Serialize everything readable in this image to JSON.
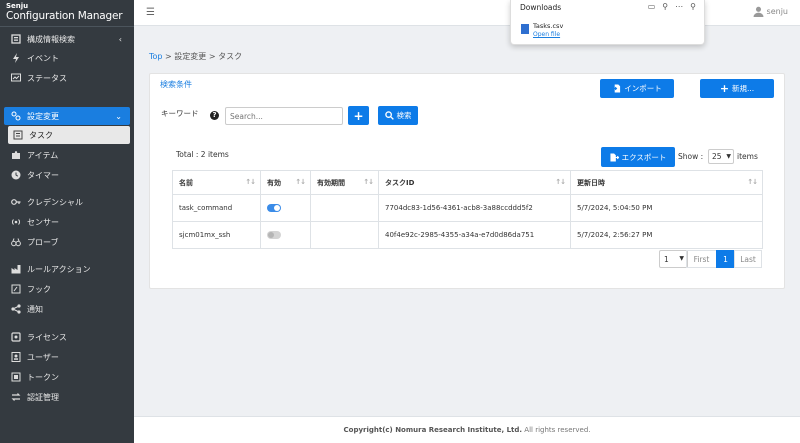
{
  "brand": {
    "line1": "Senju",
    "line2": "Configuration Manager"
  },
  "sidebar": {
    "items": [
      {
        "label": "構成情報検索",
        "icon": "catalog-icon",
        "chevron": "‹"
      },
      {
        "label": "イベント",
        "icon": "bolt-icon"
      },
      {
        "label": "ステータス",
        "icon": "monitor-icon"
      },
      {
        "label": "設定変更",
        "icon": "sliders-icon",
        "chevron": "⌄"
      },
      {
        "label": "タスク",
        "icon": "list-icon"
      },
      {
        "label": "アイテム",
        "icon": "puzzle-icon"
      },
      {
        "label": "タイマー",
        "icon": "clock-icon"
      },
      {
        "label": "クレデンシャル",
        "icon": "key-icon"
      },
      {
        "label": "センサー",
        "icon": "sensor-icon"
      },
      {
        "label": "プローブ",
        "icon": "binoculars-icon"
      },
      {
        "label": "ルールアクション",
        "icon": "factory-icon"
      },
      {
        "label": "フック",
        "icon": "hook-icon"
      },
      {
        "label": "通知",
        "icon": "share-icon"
      },
      {
        "label": "ライセンス",
        "icon": "license-icon"
      },
      {
        "label": "ユーザー",
        "icon": "user-card-icon"
      },
      {
        "label": "トークン",
        "icon": "token-icon"
      },
      {
        "label": "認証管理",
        "icon": "exchange-icon"
      }
    ]
  },
  "topbar": {
    "user": "senju"
  },
  "breadcrumb": {
    "top": "Top",
    "rest": " > 設定変更 > タスク"
  },
  "search": {
    "title": "検索条件",
    "keyword_label": "キーワード",
    "placeholder": "Search...",
    "search_button": "検索",
    "import_button": "インポート",
    "new_button": "新規..."
  },
  "list": {
    "total": "Total : 2 items",
    "export_button": "エクスポート",
    "show_label": "Show :",
    "show_value": "25",
    "items_label": "items",
    "columns": [
      "名前",
      "有効",
      "有効期間",
      "タスクID",
      "更新日時"
    ],
    "rows": [
      {
        "name": "task_command",
        "enabled": true,
        "period": "",
        "task_id": "7704dc83-1d56-4361-acb8-3a88ccddd5f2",
        "updated": "5/7/2024, 5:04:50 PM"
      },
      {
        "name": "sjcm01mx_ssh",
        "enabled": false,
        "period": "",
        "task_id": "40f4e92c-2985-4355-a34a-e7d0d86da751",
        "updated": "5/7/2024, 2:56:27 PM"
      }
    ]
  },
  "pagination": {
    "page_size": "1",
    "first": "First",
    "current": "1",
    "last": "Last"
  },
  "footer": {
    "bold": "Copyright(c) Nomura Research Institute, Ltd.",
    "rest": " All rights reserved."
  },
  "downloads": {
    "title": "Downloads",
    "file_name": "Tasks.csv",
    "open_label": "Open file"
  },
  "colors": {
    "primary": "#0d7be8",
    "sidebar_bg": "#343a40",
    "toggle_on": "#3b8ce8"
  }
}
